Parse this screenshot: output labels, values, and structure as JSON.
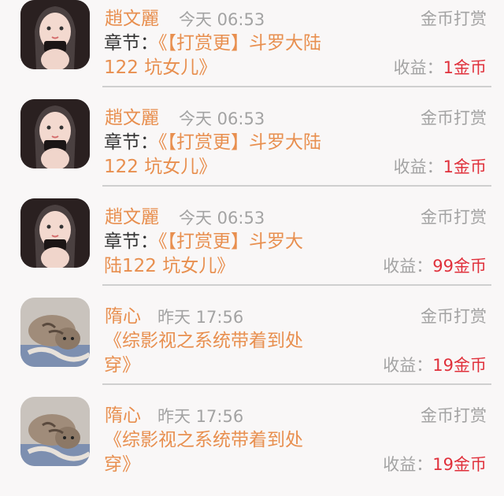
{
  "records": [
    {
      "name": "趙文麗",
      "time": "今天 06:53",
      "type": "金币打赏",
      "chapter_label": "章节：",
      "chapter_line1": "《【打赏更】斗罗大陆",
      "chapter_line2": "122 坑女儿》",
      "earn_label": "收益：",
      "earn_amount": "1金币",
      "avatar": "girl-avatar"
    },
    {
      "name": "趙文麗",
      "time": "今天 06:53",
      "type": "金币打赏",
      "chapter_label": "章节：",
      "chapter_line1": "《【打赏更】斗罗大陆",
      "chapter_line2": "122 坑女儿》",
      "earn_label": "收益：",
      "earn_amount": "1金币",
      "avatar": "girl-avatar"
    },
    {
      "name": "趙文麗",
      "time": "今天 06:53",
      "type": "金币打赏",
      "chapter_label": "章节：",
      "chapter_line1": "《【打赏更】斗罗大",
      "chapter_line2": "陆122 坑女儿》",
      "earn_label": "收益：",
      "earn_amount": "99金币",
      "avatar": "girl-avatar"
    },
    {
      "name": "隋心",
      "time": "昨天 17:56",
      "type": "金币打赏",
      "chapter_label": "",
      "chapter_line1": "《综影视之系统带着到处",
      "chapter_line2": "穿》",
      "earn_label": "收益：",
      "earn_amount": "19金币",
      "avatar": "cat-avatar"
    },
    {
      "name": "隋心",
      "time": "昨天 17:56",
      "type": "金币打赏",
      "chapter_label": "",
      "chapter_line1": "《综影视之系统带着到处",
      "chapter_line2": "穿》",
      "earn_label": "收益：",
      "earn_amount": "19金币",
      "avatar": "cat-avatar"
    }
  ],
  "colors": {
    "name": "#e88f4f",
    "chapter": "#e88f4f",
    "muted": "#a3a3a3",
    "amount": "#e0303b",
    "background": "#f9f7f7"
  }
}
